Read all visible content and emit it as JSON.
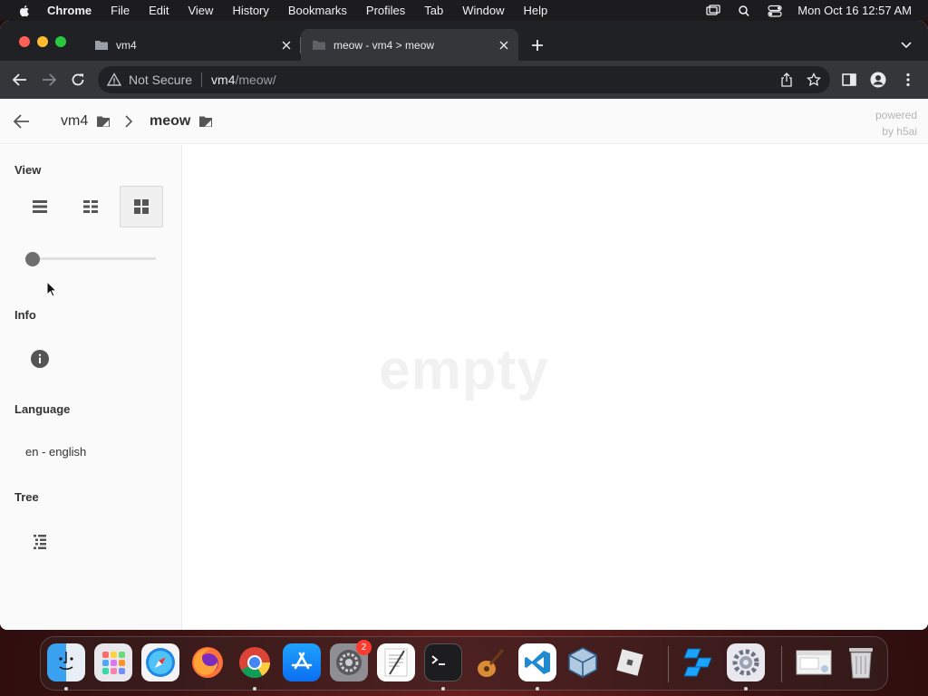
{
  "menubar": {
    "app_name": "Chrome",
    "items": [
      "File",
      "Edit",
      "View",
      "History",
      "Bookmarks",
      "Profiles",
      "Tab",
      "Window",
      "Help"
    ],
    "clock": "Mon Oct 16  12:57 AM"
  },
  "browser": {
    "tabs": [
      {
        "title": "vm4",
        "active": false
      },
      {
        "title": "meow - vm4 > meow",
        "active": true
      }
    ],
    "omnibox": {
      "security_label": "Not Secure",
      "host": "vm4",
      "path": "/meow/"
    }
  },
  "page": {
    "breadcrumb": [
      {
        "label": "vm4"
      },
      {
        "label": "meow"
      }
    ],
    "powered_by": {
      "line1": "powered",
      "line2": "by h5ai"
    },
    "empty_text": "empty",
    "sidebar": {
      "view_title": "View",
      "view_modes": [
        "details",
        "grid",
        "icons"
      ],
      "active_view": "icons",
      "size_slider_value": 0,
      "info_title": "Info",
      "language_title": "Language",
      "language_value": "en - english",
      "tree_title": "Tree"
    }
  },
  "dock": {
    "apps": [
      {
        "name": "Finder",
        "icon": "finder-icon"
      },
      {
        "name": "Launchpad",
        "icon": "launchpad-icon"
      },
      {
        "name": "Safari",
        "icon": "safari-icon"
      },
      {
        "name": "Firefox",
        "icon": "firefox-icon"
      },
      {
        "name": "Google Chrome",
        "icon": "chrome-icon"
      },
      {
        "name": "App Store",
        "icon": "app-store-icon"
      },
      {
        "name": "System Preferences",
        "icon": "system-preferences-icon",
        "badge": "2"
      },
      {
        "name": "TextEdit",
        "icon": "textedit-icon"
      },
      {
        "name": "Terminal",
        "icon": "terminal-icon"
      },
      {
        "name": "GarageBand",
        "icon": "garageband-icon"
      },
      {
        "name": "Visual Studio Code",
        "icon": "vscode-icon"
      },
      {
        "name": "VirtualBox",
        "icon": "virtualbox-icon"
      },
      {
        "name": "Roblox",
        "icon": "roblox-icon"
      },
      {
        "name": "Roblox Studio",
        "icon": "roblox-studio-icon"
      },
      {
        "name": "Settings",
        "icon": "settings-icon"
      },
      {
        "name": "Screenshot",
        "icon": "screenshot-icon"
      },
      {
        "name": "Trash",
        "icon": "trash-icon"
      }
    ]
  },
  "colors": {
    "menubar_bg": "#1c1c1e",
    "tabstrip_bg": "#202124",
    "toolbar_bg": "#35363a",
    "sidebar_bg": "#fafafa",
    "badge_red": "#ff3b30"
  }
}
